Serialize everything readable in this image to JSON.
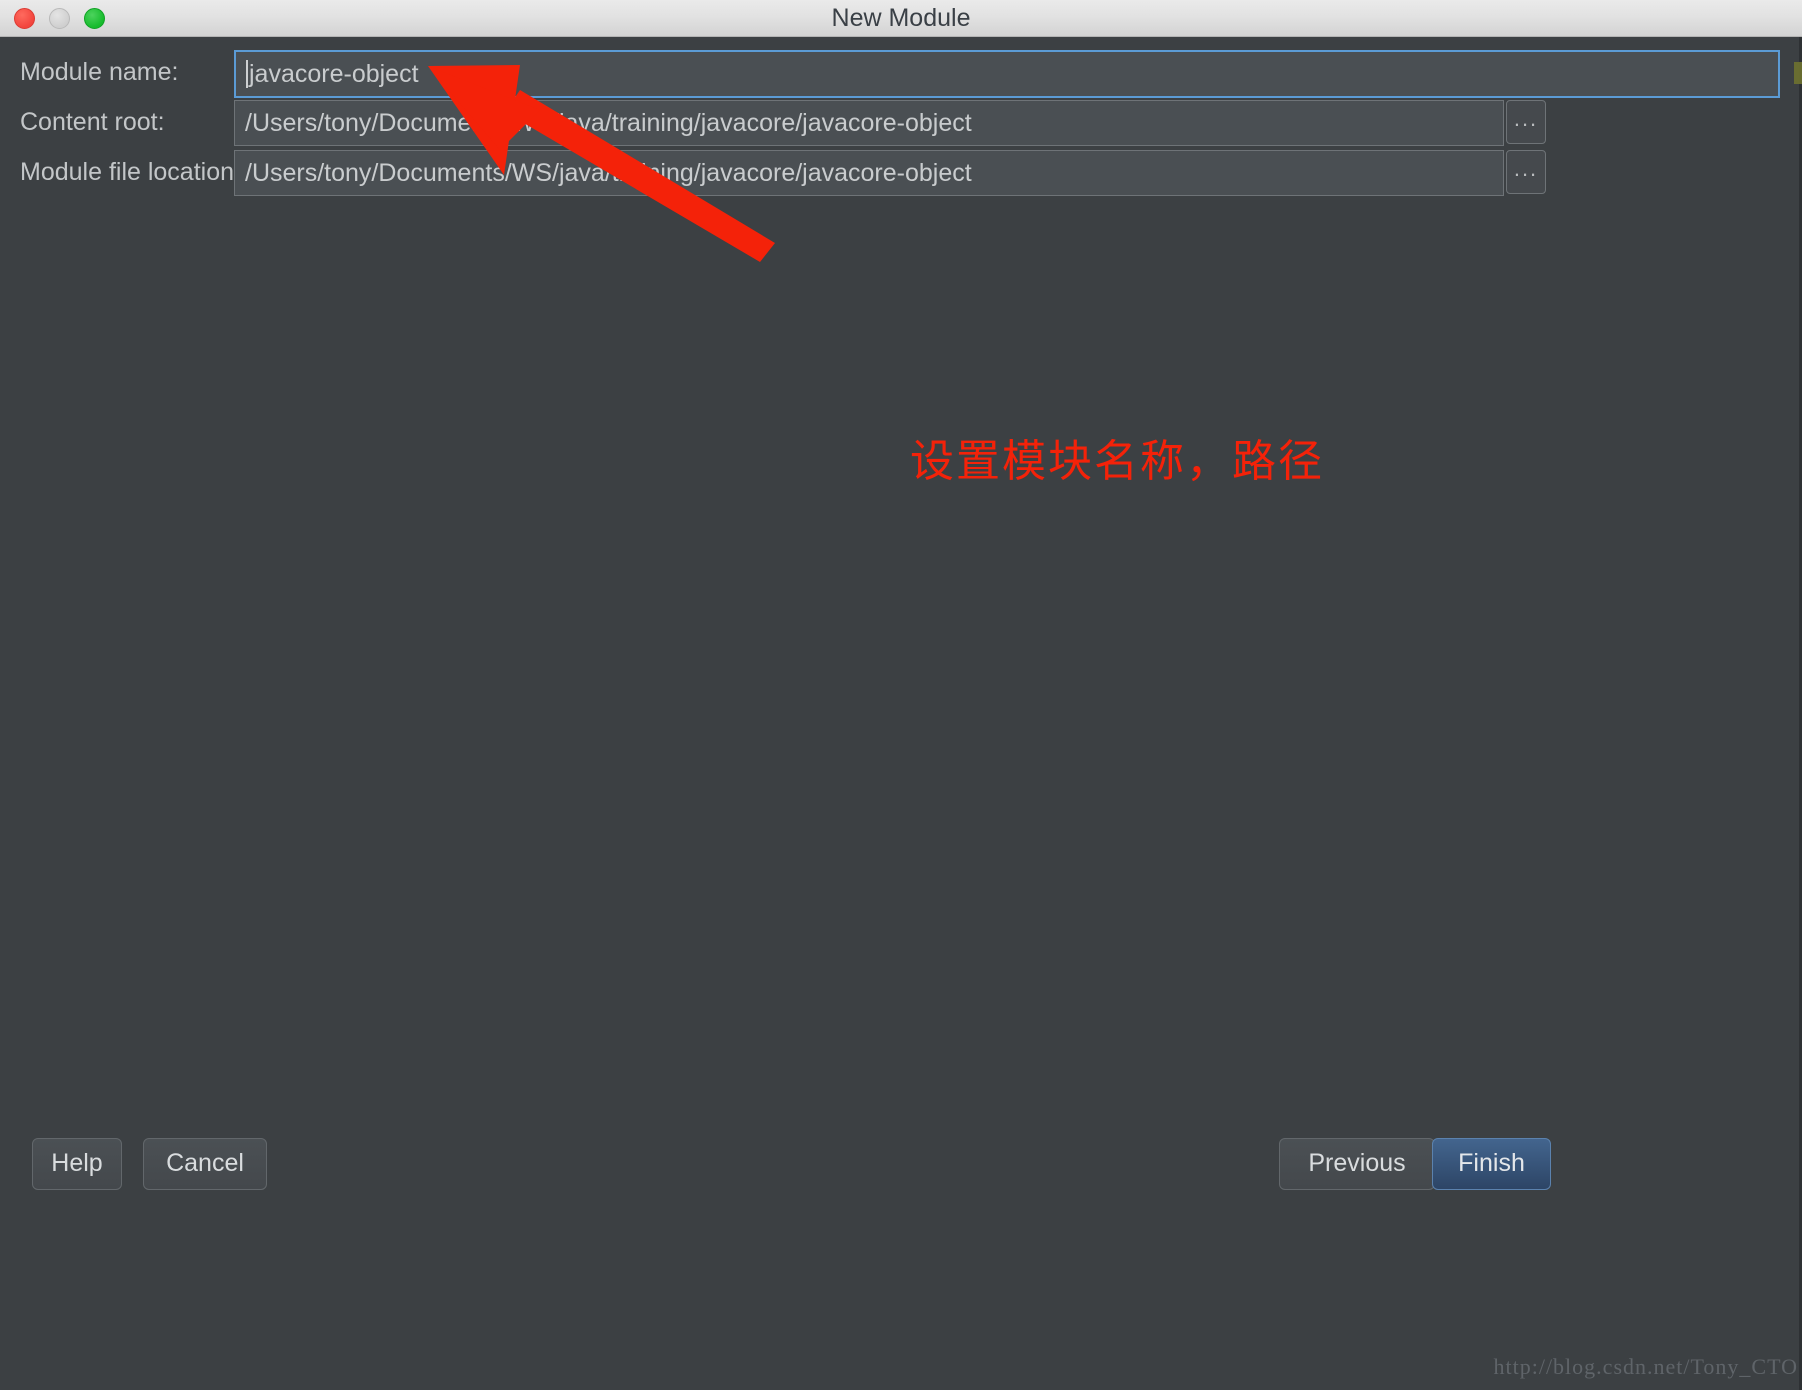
{
  "window": {
    "title": "New Module",
    "traffic_lights": [
      {
        "name": "close",
        "color": "#f2453d"
      },
      {
        "name": "minimize",
        "color": "#cfcfcf"
      },
      {
        "name": "maximize",
        "color": "#16bb2c"
      }
    ]
  },
  "form": {
    "rows": [
      {
        "label": "Module name:",
        "value": "javacore-object",
        "focused": true,
        "has_browse": false,
        "browse_label": ""
      },
      {
        "label": "Content root:",
        "value": "/Users/tony/Documents/WS/java/training/javacore/javacore-object",
        "focused": false,
        "has_browse": true,
        "browse_label": "..."
      },
      {
        "label": "Module file location:",
        "value": "/Users/tony/Documents/WS/java/training/javacore/javacore-object",
        "focused": false,
        "has_browse": true,
        "browse_label": "..."
      }
    ]
  },
  "annotation": {
    "text": "设置模块名称，路径",
    "color": "#f42209"
  },
  "footer": {
    "help_label": "Help",
    "cancel_label": "Cancel",
    "previous_label": "Previous",
    "finish_label": "Finish"
  },
  "watermark": {
    "text": "http://blog.csdn.net/Tony_CTO"
  },
  "colors": {
    "dialog_background": "#3c4043",
    "field_background": "#4a4f53",
    "focus_border": "#5b9bd5",
    "primary_button": "#3a5a80",
    "titlebar": "#e2e2e2"
  }
}
